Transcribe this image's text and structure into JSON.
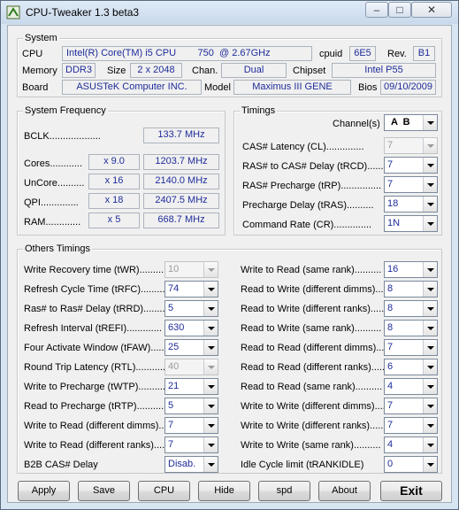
{
  "window": {
    "title": "CPU-Tweaker 1.3 beta3",
    "min_glyph": "–",
    "max_glyph": "□",
    "close_glyph": "✕"
  },
  "system": {
    "legend": "System",
    "cpu_label": "CPU",
    "cpu_value": "Intel(R) Core(TM) i5 CPU        750  @ 2.67GHz",
    "cpuid_label": "cpuid",
    "cpuid_value": "6E5",
    "rev_label": "Rev.",
    "rev_value": "B1",
    "memory_label": "Memory",
    "memory_value": "DDR3",
    "size_label": "Size",
    "size_value": "2 x 2048",
    "chan_label": "Chan.",
    "chan_value": "Dual",
    "chipset_label": "Chipset",
    "chipset_value": "Intel P55",
    "board_label": "Board",
    "board_value": "ASUSTeK Computer INC.",
    "model_label": "Model",
    "model_value": "Maximus III GENE",
    "bios_label": "Bios",
    "bios_value": "09/10/2009"
  },
  "freq": {
    "legend": "System Frequency",
    "bclk_label": "BCLK...................",
    "bclk_value": "133.7 MHz",
    "rows": [
      {
        "label": "Cores............",
        "mult": "x 9.0",
        "value": "1203.7 MHz"
      },
      {
        "label": "UnCore..........",
        "mult": "x 16",
        "value": "2140.0 MHz"
      },
      {
        "label": "QPI..............",
        "mult": "x 18",
        "value": "2407.5 MHz"
      },
      {
        "label": "RAM.............",
        "mult": "x 5",
        "value": "668.7 MHz"
      }
    ]
  },
  "timings": {
    "legend": "Timings",
    "channel_label": "Channel(s)",
    "channel_value": "A  B",
    "rows": [
      {
        "label": "CAS# Latency (CL)..............",
        "value": "7",
        "disabled": true
      },
      {
        "label": "RAS# to CAS# Delay (tRCD).......",
        "value": "7",
        "disabled": false
      },
      {
        "label": "RAS# Precharge (tRP)...............",
        "value": "7",
        "disabled": false
      },
      {
        "label": "Precharge Delay (tRAS)..........",
        "value": "18",
        "disabled": false
      },
      {
        "label": "Command Rate (CR)..............",
        "value": "1N",
        "disabled": false
      }
    ]
  },
  "others": {
    "legend": "Others Timings",
    "left": [
      {
        "label": "Write Recovery time (tWR)..........",
        "value": "10",
        "disabled": true
      },
      {
        "label": "Refresh Cycle Time (tRFC)..........",
        "value": "74",
        "disabled": false
      },
      {
        "label": "Ras# to Ras# Delay (tRRD)..........",
        "value": "5",
        "disabled": false
      },
      {
        "label": "Refresh Interval (tREFI).............",
        "value": "630",
        "disabled": false
      },
      {
        "label": "Four Activate Window (tFAW)......",
        "value": "25",
        "disabled": false
      },
      {
        "label": "Round Trip Latency (RTL)...........",
        "value": "40",
        "disabled": true
      },
      {
        "label": "Write to Precharge (tWTP)..........",
        "value": "21",
        "disabled": false
      },
      {
        "label": "Read to Precharge (tRTP)..........",
        "value": "5",
        "disabled": false
      },
      {
        "label": "Write to Read (different dimms)...",
        "value": "7",
        "disabled": false
      },
      {
        "label": "Write to Read (different ranks)....",
        "value": "7",
        "disabled": false
      },
      {
        "label": "B2B CAS# Delay",
        "value": "Disab.",
        "disabled": false
      }
    ],
    "right": [
      {
        "label": "Write to Read (same rank)..........",
        "value": "16"
      },
      {
        "label": "Read to Write (different dimms).....",
        "value": "8"
      },
      {
        "label": "Read to Write (different ranks)......",
        "value": "8"
      },
      {
        "label": "Read to Write (same rank)..........",
        "value": "8"
      },
      {
        "label": "Read to Read (different dimms).....",
        "value": "7"
      },
      {
        "label": "Read to Read (different ranks)......",
        "value": "6"
      },
      {
        "label": "Read to Read (same rank)..........",
        "value": "4"
      },
      {
        "label": "Write to Write (different dimms)....",
        "value": "7"
      },
      {
        "label": "Write to Write (different ranks).....",
        "value": "7"
      },
      {
        "label": "Write to Write (same rank)..........",
        "value": "4"
      },
      {
        "label": "Idle Cycle limit (tRANKIDLE)",
        "value": "0"
      }
    ]
  },
  "buttons": {
    "apply": "Apply",
    "save": "Save",
    "cpu": "CPU",
    "hide": "Hide",
    "spd": "spd",
    "about": "About",
    "exit": "Exit"
  }
}
